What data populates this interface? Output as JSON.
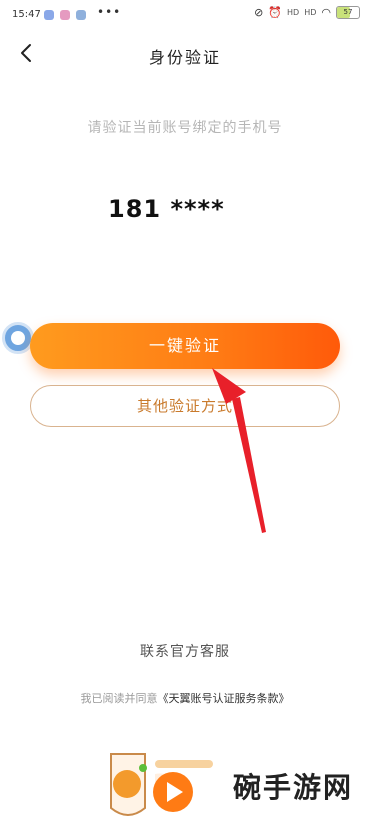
{
  "status_bar": {
    "time": "15:47",
    "dots": "•••",
    "signal_1": "HD",
    "signal_2": "HD",
    "battery_level": 0.57,
    "battery_text": "57"
  },
  "header": {
    "title": "身份验证"
  },
  "main": {
    "subtitle": "请验证当前账号绑定的手机号",
    "phone_masked": "181 ****"
  },
  "buttons": {
    "primary": "一键验证",
    "secondary": "其他验证方式"
  },
  "footer": {
    "contact": "联系官方客服",
    "agreement_prefix": "我已阅读并同意",
    "agreement_link": "《天翼账号认证服务条款》"
  },
  "watermark": {
    "text": "碗手游网"
  },
  "colors": {
    "accent_orange": "#ff7b14",
    "secondary_border": "#d9b38f",
    "annotation_arrow": "#e8202a"
  }
}
